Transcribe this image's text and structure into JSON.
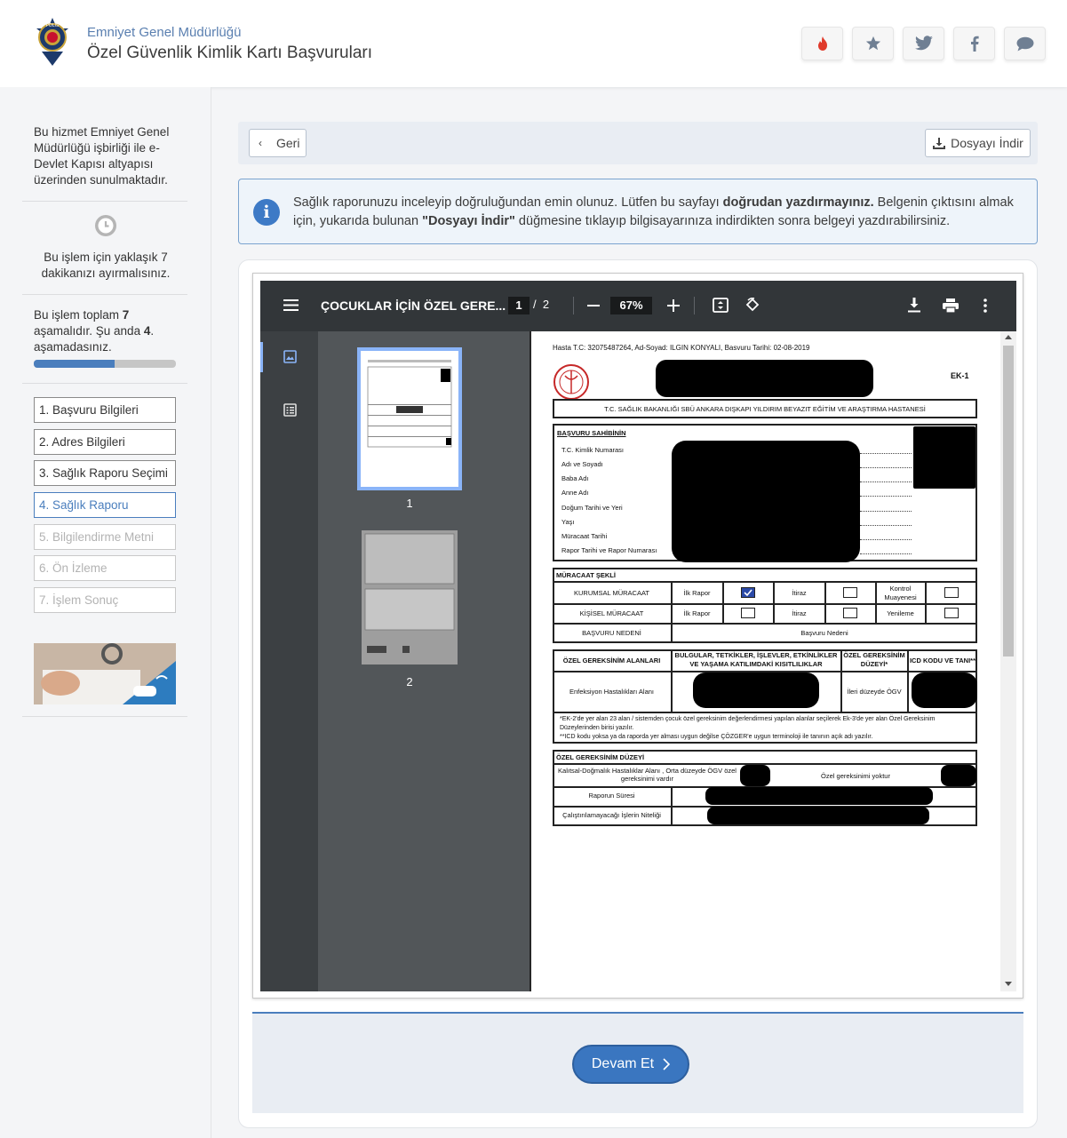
{
  "header": {
    "org": "Emniyet Genel Müdürlüğü",
    "title": "Özel Güvenlik Kimlik Kartı Başvuruları",
    "logo_text": "POLİS",
    "buttons": [
      {
        "icon": "fire-icon",
        "color": "#e03a2b"
      },
      {
        "icon": "star-icon",
        "color": "#6f7f93"
      },
      {
        "icon": "twitter-icon",
        "color": "#6f7f93"
      },
      {
        "icon": "facebook-icon",
        "color": "#6f7f93"
      },
      {
        "icon": "comment-icon",
        "color": "#6f7f93"
      }
    ]
  },
  "sidebar": {
    "intro": "Bu hizmet Emniyet Genel Müdürlüğü işbirliği ile e-Devlet Kapısı altyapısı üzerinden sunulmaktadır.",
    "time_text": "Bu işlem için yaklaşık 7 dakikanızı ayırmalısınız.",
    "steps_pre": "Bu işlem toplam ",
    "steps_total": "7",
    "steps_mid": " aşamalıdır. Şu anda ",
    "steps_current": "4",
    "steps_post": ". aşamadasınız.",
    "progress": 0.57,
    "steps": [
      {
        "label": "1. Başvuru Bilgileri",
        "state": "done"
      },
      {
        "label": "2. Adres Bilgileri",
        "state": "done"
      },
      {
        "label": "3. Sağlık Raporu Seçimi",
        "state": "done"
      },
      {
        "label": "4. Sağlık Raporu",
        "state": "current"
      },
      {
        "label": "5. Bilgilendirme Metni",
        "state": "disabled"
      },
      {
        "label": "6. Ön İzleme",
        "state": "disabled"
      },
      {
        "label": "7. İşlem Sonuç",
        "state": "disabled"
      }
    ]
  },
  "toolbar": {
    "back": "Geri",
    "download": "Dosyayı İndir"
  },
  "alert": {
    "t1": "Sağlık raporunuzu inceleyip doğruluğundan emin olunuz. Lütfen bu sayfayı ",
    "b1": "doğrudan yazdırmayınız.",
    "t2": " Belgenin çıktısını almak için, yukarıda bulunan ",
    "b2": "\"Dosyayı İndir\"",
    "t3": " düğmesine tıklayıp bilgisayarınıza indirdikten sonra belgeyi yazdırabilirsiniz."
  },
  "pdf": {
    "title": "ÇOCUKLAR İÇİN ÖZEL GERE...",
    "page": "1",
    "sep": "/",
    "pages": "2",
    "zoom": "67%",
    "thumb1": "1",
    "thumb2": "2"
  },
  "report": {
    "header_line": "Hasta T.C: 32075487264, Ad-Soyad: ILGIN KONYALI, Basvuru Tarihi: 02-08-2019",
    "ek": "EK-1",
    "hospital": "T.C. SAĞLIK BAKANLIĞI SBÜ ANKARA DIŞKAPI YILDIRIM BEYAZIT EĞİTİM VE ARAŞTIRMA HASTANESİ",
    "applicant_title": "BAŞVURU SAHİBİNİN",
    "fields": [
      "T.C. Kimlik Numarası",
      "Adı ve Soyadı",
      "Baba Adı",
      "Anne Adı",
      "Doğum Tarihi ve Yeri",
      "Yaşı",
      "Müracaat Tarihi",
      "Rapor Tarihi ve Rapor Numarası"
    ],
    "app_type_title": "MÜRACAAT ŞEKLİ",
    "kurumsal": "KURUMSAL MÜRACAAT",
    "kisisel": "KİŞİSEL MÜRACAAT",
    "ilk_rapor": "İlk Rapor",
    "itiraz": "İtiraz",
    "kontrol": "Kontrol Muayenesi",
    "yenileme": "Yenileme",
    "basvuru_nedeni": "BAŞVURU NEDENİ",
    "basvuru_nedeni_val": "Başvuru Nedeni",
    "col1": "ÖZEL GEREKSİNİM ALANLARI",
    "col2": "BULGULAR, TETKİKLER, İŞLEVLER, ETKİNLİKLER VE YAŞAMA KATILIMDAKİ KISITLILIKLAR",
    "col3": "ÖZEL GEREKSİNİM DÜZEYİ*",
    "col4": "ICD KODU VE TANI**",
    "row_area": "Enfeksiyon Hastalıkları Alanı",
    "row_level": "İleri düzeyde ÖGV",
    "note1": "*EK-2'de yer alan 23 alan / sistemden çocuk özel gereksinim değerlendirmesi yapılan alanlar seçilerek Ek-3'de yer alan Özel Gereksinim Düzeylerinden birisi yazılır.",
    "note2": "**ICD kodu yoksa ya da raporda yer alması uygun değilse ÇÖZGER'e uygun terminoloji ile tanının açık adı yazılır.",
    "level_title": "ÖZEL GEREKSİNİM DÜZEYİ",
    "level_left": "Kalıtsal-Doğmalık Hastalıklar Alanı , Orta düzeyde ÖGV özel gereksinimi vardır",
    "level_right": "Özel gereksinimi yoktur",
    "duration": "Raporun Süresi",
    "jobs": "Çalıştırılamayacağı İşlerin Niteliği"
  },
  "footer": {
    "next": "Devam Et"
  }
}
